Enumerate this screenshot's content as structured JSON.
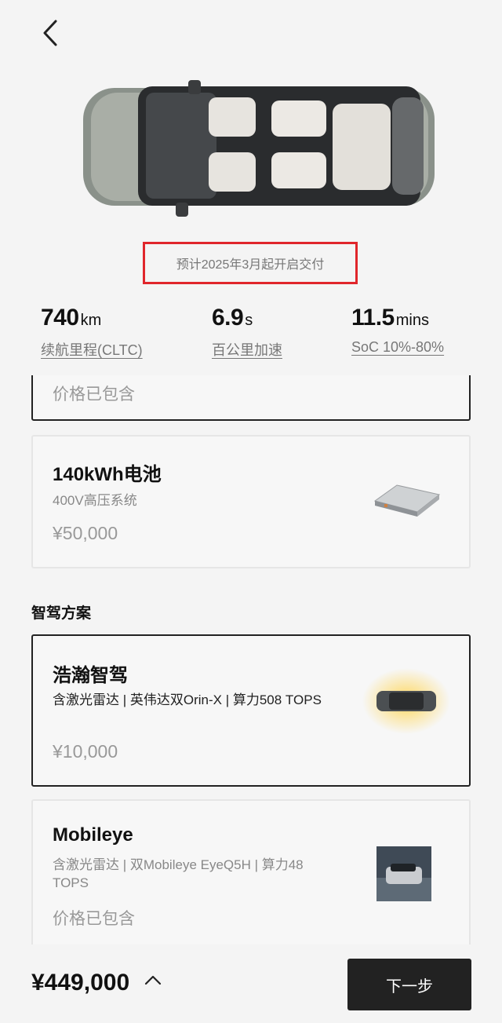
{
  "header": {
    "back_icon": "chevron-left-icon"
  },
  "delivery_notice": "预计2025年3月起开启交付",
  "stats": [
    {
      "value": "740",
      "unit": "km",
      "label": "续航里程(CLTC)"
    },
    {
      "value": "6.9",
      "unit": "s",
      "label": "百公里加速"
    },
    {
      "value": "11.5",
      "unit": "mins",
      "label": "SoC 10%-80%"
    }
  ],
  "options": {
    "partial_card": {
      "price": "价格已包含"
    },
    "battery": {
      "title": "140kWh电池",
      "subtitle": "400V高压系统",
      "price": "¥50,000"
    },
    "adas_section_title": "智驾方案",
    "adas": [
      {
        "title": "浩瀚智驾",
        "desc": "含激光雷达 | 英伟达双Orin-X | 算力508 TOPS",
        "price": "¥10,000",
        "selected": true
      },
      {
        "title": "Mobileye",
        "desc": "含激光雷达 | 双Mobileye EyeQ5H | 算力48 TOPS",
        "price": "价格已包含",
        "selected": false
      }
    ]
  },
  "bottom_bar": {
    "total_price": "¥449,000",
    "expand_icon": "chevron-up-icon",
    "next_label": "下一步"
  },
  "colors": {
    "highlight_border": "#e0262b",
    "primary_button": "#222222",
    "background": "#f4f4f4"
  }
}
